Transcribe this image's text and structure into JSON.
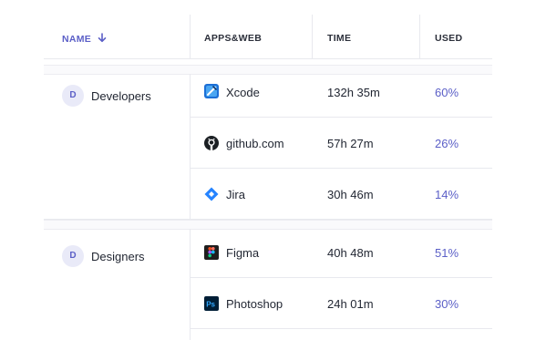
{
  "header": {
    "name": "NAME",
    "apps": "APPS&WEB",
    "time": "TIME",
    "used": "USED"
  },
  "groups": [
    {
      "initial": "D",
      "name": "Developers",
      "rows": [
        {
          "icon": "xcode-icon",
          "app": "Xcode",
          "time": "132h 35m",
          "used": "60%"
        },
        {
          "icon": "github-icon",
          "app": "github.com",
          "time": "57h 27m",
          "used": "26%"
        },
        {
          "icon": "jira-icon",
          "app": "Jira",
          "time": "30h 46m",
          "used": "14%"
        }
      ]
    },
    {
      "initial": "D",
      "name": "Designers",
      "rows": [
        {
          "icon": "figma-icon",
          "app": "Figma",
          "time": "40h 48m",
          "used": "51%"
        },
        {
          "icon": "photoshop-icon",
          "app": "Photoshop",
          "time": "24h 01m",
          "used": "30%"
        }
      ]
    }
  ],
  "colors": {
    "accent": "#5b5fc7",
    "border": "#e8e9ee"
  }
}
